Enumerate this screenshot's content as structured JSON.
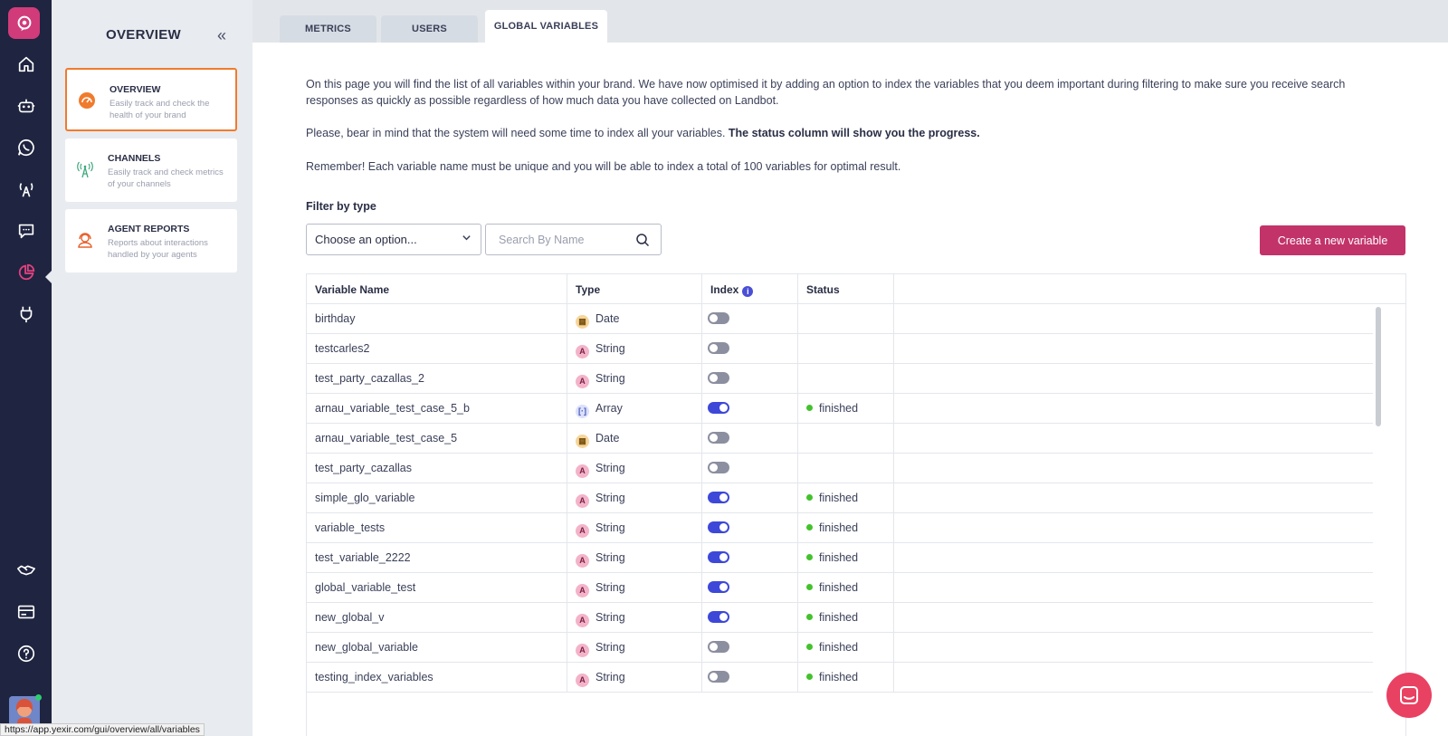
{
  "sidebar": {
    "title": "OVERVIEW",
    "collapse_icon": "double-chevron-left-icon",
    "cards": [
      {
        "title": "OVERVIEW",
        "description": "Easily track and check the health of your brand",
        "icon": "speedometer-icon",
        "active": true
      },
      {
        "title": "CHANNELS",
        "description": "Easily track and check metrics of your channels",
        "icon": "antenna-icon",
        "active": false
      },
      {
        "title": "AGENT REPORTS",
        "description": "Reports about interactions handled by your agents",
        "icon": "agent-headset-icon",
        "active": false
      }
    ]
  },
  "rail": {
    "icons": [
      "home-icon",
      "bot-icon",
      "whatsapp-icon",
      "broadcast-icon",
      "chat-bubble-icon",
      "analytics-pie-icon",
      "plug-icon",
      "handshake-icon",
      "billing-icon",
      "help-icon"
    ],
    "active": "analytics-pie-icon"
  },
  "tabs": [
    {
      "label": "METRICS",
      "active": false
    },
    {
      "label": "USERS",
      "active": false
    },
    {
      "label": "GLOBAL VARIABLES",
      "active": true
    }
  ],
  "intro": {
    "p1": "On this page you will find the list of all variables within your brand. We have now optimised it by adding an option to index the variables that you deem important during filtering to make sure you receive search responses as quickly as possible regardless of how much data you have collected on Landbot.",
    "p2_plain": "Please, bear in mind that the system will need some time to index all your variables. ",
    "p2_bold": "The status column will show you the progress.",
    "p3": "Remember! Each variable name must be unique and you will be able to index a total of 100 variables for optimal result."
  },
  "filter": {
    "label": "Filter by type",
    "select_value": "Choose an option...",
    "search_placeholder": "Search By Name"
  },
  "create_button": "Create a new variable",
  "table": {
    "headers": [
      "Variable Name",
      "Type",
      "Index",
      "Status"
    ],
    "index_info_icon": "info-icon",
    "rows": [
      {
        "name": "birthday",
        "type": "Date",
        "indexed": false,
        "status": ""
      },
      {
        "name": "testcarles2",
        "type": "String",
        "indexed": false,
        "status": ""
      },
      {
        "name": "test_party_cazallas_2",
        "type": "String",
        "indexed": false,
        "status": ""
      },
      {
        "name": "arnau_variable_test_case_5_b",
        "type": "Array",
        "indexed": true,
        "status": "finished"
      },
      {
        "name": "arnau_variable_test_case_5",
        "type": "Date",
        "indexed": false,
        "status": ""
      },
      {
        "name": "test_party_cazallas",
        "type": "String",
        "indexed": false,
        "status": ""
      },
      {
        "name": "simple_glo_variable",
        "type": "String",
        "indexed": true,
        "status": "finished"
      },
      {
        "name": "variable_tests",
        "type": "String",
        "indexed": true,
        "status": "finished"
      },
      {
        "name": "test_variable_2222",
        "type": "String",
        "indexed": true,
        "status": "finished"
      },
      {
        "name": "global_variable_test",
        "type": "String",
        "indexed": true,
        "status": "finished"
      },
      {
        "name": "new_global_v",
        "type": "String",
        "indexed": true,
        "status": "finished"
      },
      {
        "name": "new_global_variable",
        "type": "String",
        "indexed": false,
        "status": "finished"
      },
      {
        "name": "testing_index_variables",
        "type": "String",
        "indexed": false,
        "status": "finished"
      }
    ]
  },
  "status_url": "https://app.yexir.com/gui/overview/all/variables",
  "chat_icon": "chat-widget-icon"
}
